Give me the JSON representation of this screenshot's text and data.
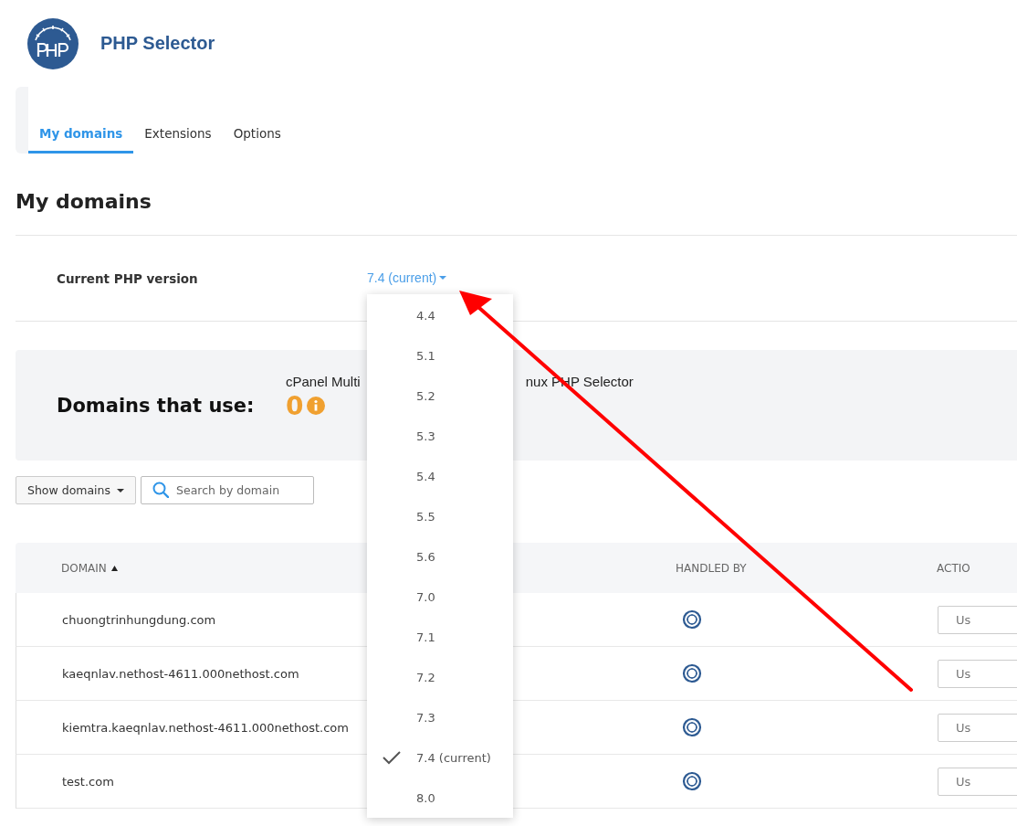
{
  "app": {
    "title": "PHP Selector"
  },
  "tabs": [
    {
      "label": "My domains",
      "selected": true
    },
    {
      "label": "Extensions",
      "selected": false
    },
    {
      "label": "Options",
      "selected": false
    }
  ],
  "heading": "My domains",
  "current_version": {
    "label": "Current PHP version",
    "value": "7.4 (current)"
  },
  "version_menu": {
    "items": [
      {
        "label": "4.4",
        "selected": false
      },
      {
        "label": "5.1",
        "selected": false
      },
      {
        "label": "5.2",
        "selected": false
      },
      {
        "label": "5.3",
        "selected": false
      },
      {
        "label": "5.4",
        "selected": false
      },
      {
        "label": "5.5",
        "selected": false
      },
      {
        "label": "5.6",
        "selected": false
      },
      {
        "label": "7.0",
        "selected": false
      },
      {
        "label": "7.1",
        "selected": false
      },
      {
        "label": "7.2",
        "selected": false
      },
      {
        "label": "7.3",
        "selected": false
      },
      {
        "label": "7.4 (current)",
        "selected": true
      },
      {
        "label": "8.0",
        "selected": false
      }
    ]
  },
  "usage": {
    "title": "Domains that use:",
    "text_left": "cPanel Multi",
    "text_right": "nux PHP Selector",
    "count": "0"
  },
  "toolbar": {
    "filter_button": "Show domains",
    "search": {
      "placeholder": "Search by domain"
    }
  },
  "table": {
    "columns": [
      {
        "label": "DOMAIN",
        "sorted": true
      },
      {
        "label": "HANDLED BY",
        "sorted": false
      },
      {
        "label": "ACTIO",
        "sorted": false
      }
    ],
    "rows": [
      {
        "domain": "chuongtrinhungdung.com",
        "action": "Us"
      },
      {
        "domain": "kaeqnlav.nethost-4611.000nethost.com",
        "action": "Us"
      },
      {
        "domain": "kiemtra.kaeqnlav.nethost-4611.000nethost.com",
        "action": "Us"
      },
      {
        "domain": "test.com",
        "action": "Us"
      }
    ]
  }
}
